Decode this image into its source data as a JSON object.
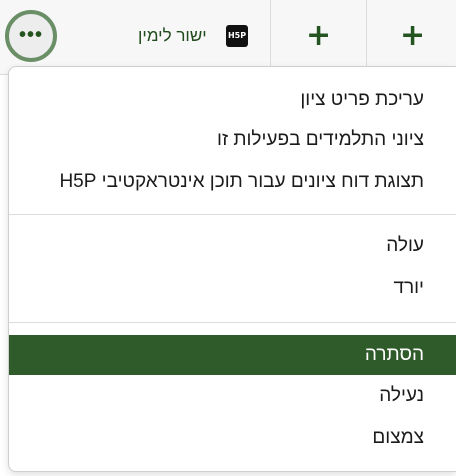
{
  "header": {
    "more_label": "•••",
    "activity_name": "ישור לימין",
    "activity_icon_text": "H5P",
    "add_buttons": [
      "+",
      "+"
    ]
  },
  "menu": {
    "group1": [
      "עריכת פריט ציון",
      "ציוני התלמידים בפעילות זו",
      "תצוגת דוח ציונים עבור תוכן אינטראקטיבי H5P"
    ],
    "group2": [
      "עולה",
      "יורד"
    ],
    "group3": [
      "הסתרה",
      "נעילה",
      "צמצום"
    ],
    "active_item": "הסתרה"
  },
  "colors": {
    "accent": "#2f5a2a",
    "accent_text": "#24541f",
    "ring": "#6a8f66"
  }
}
